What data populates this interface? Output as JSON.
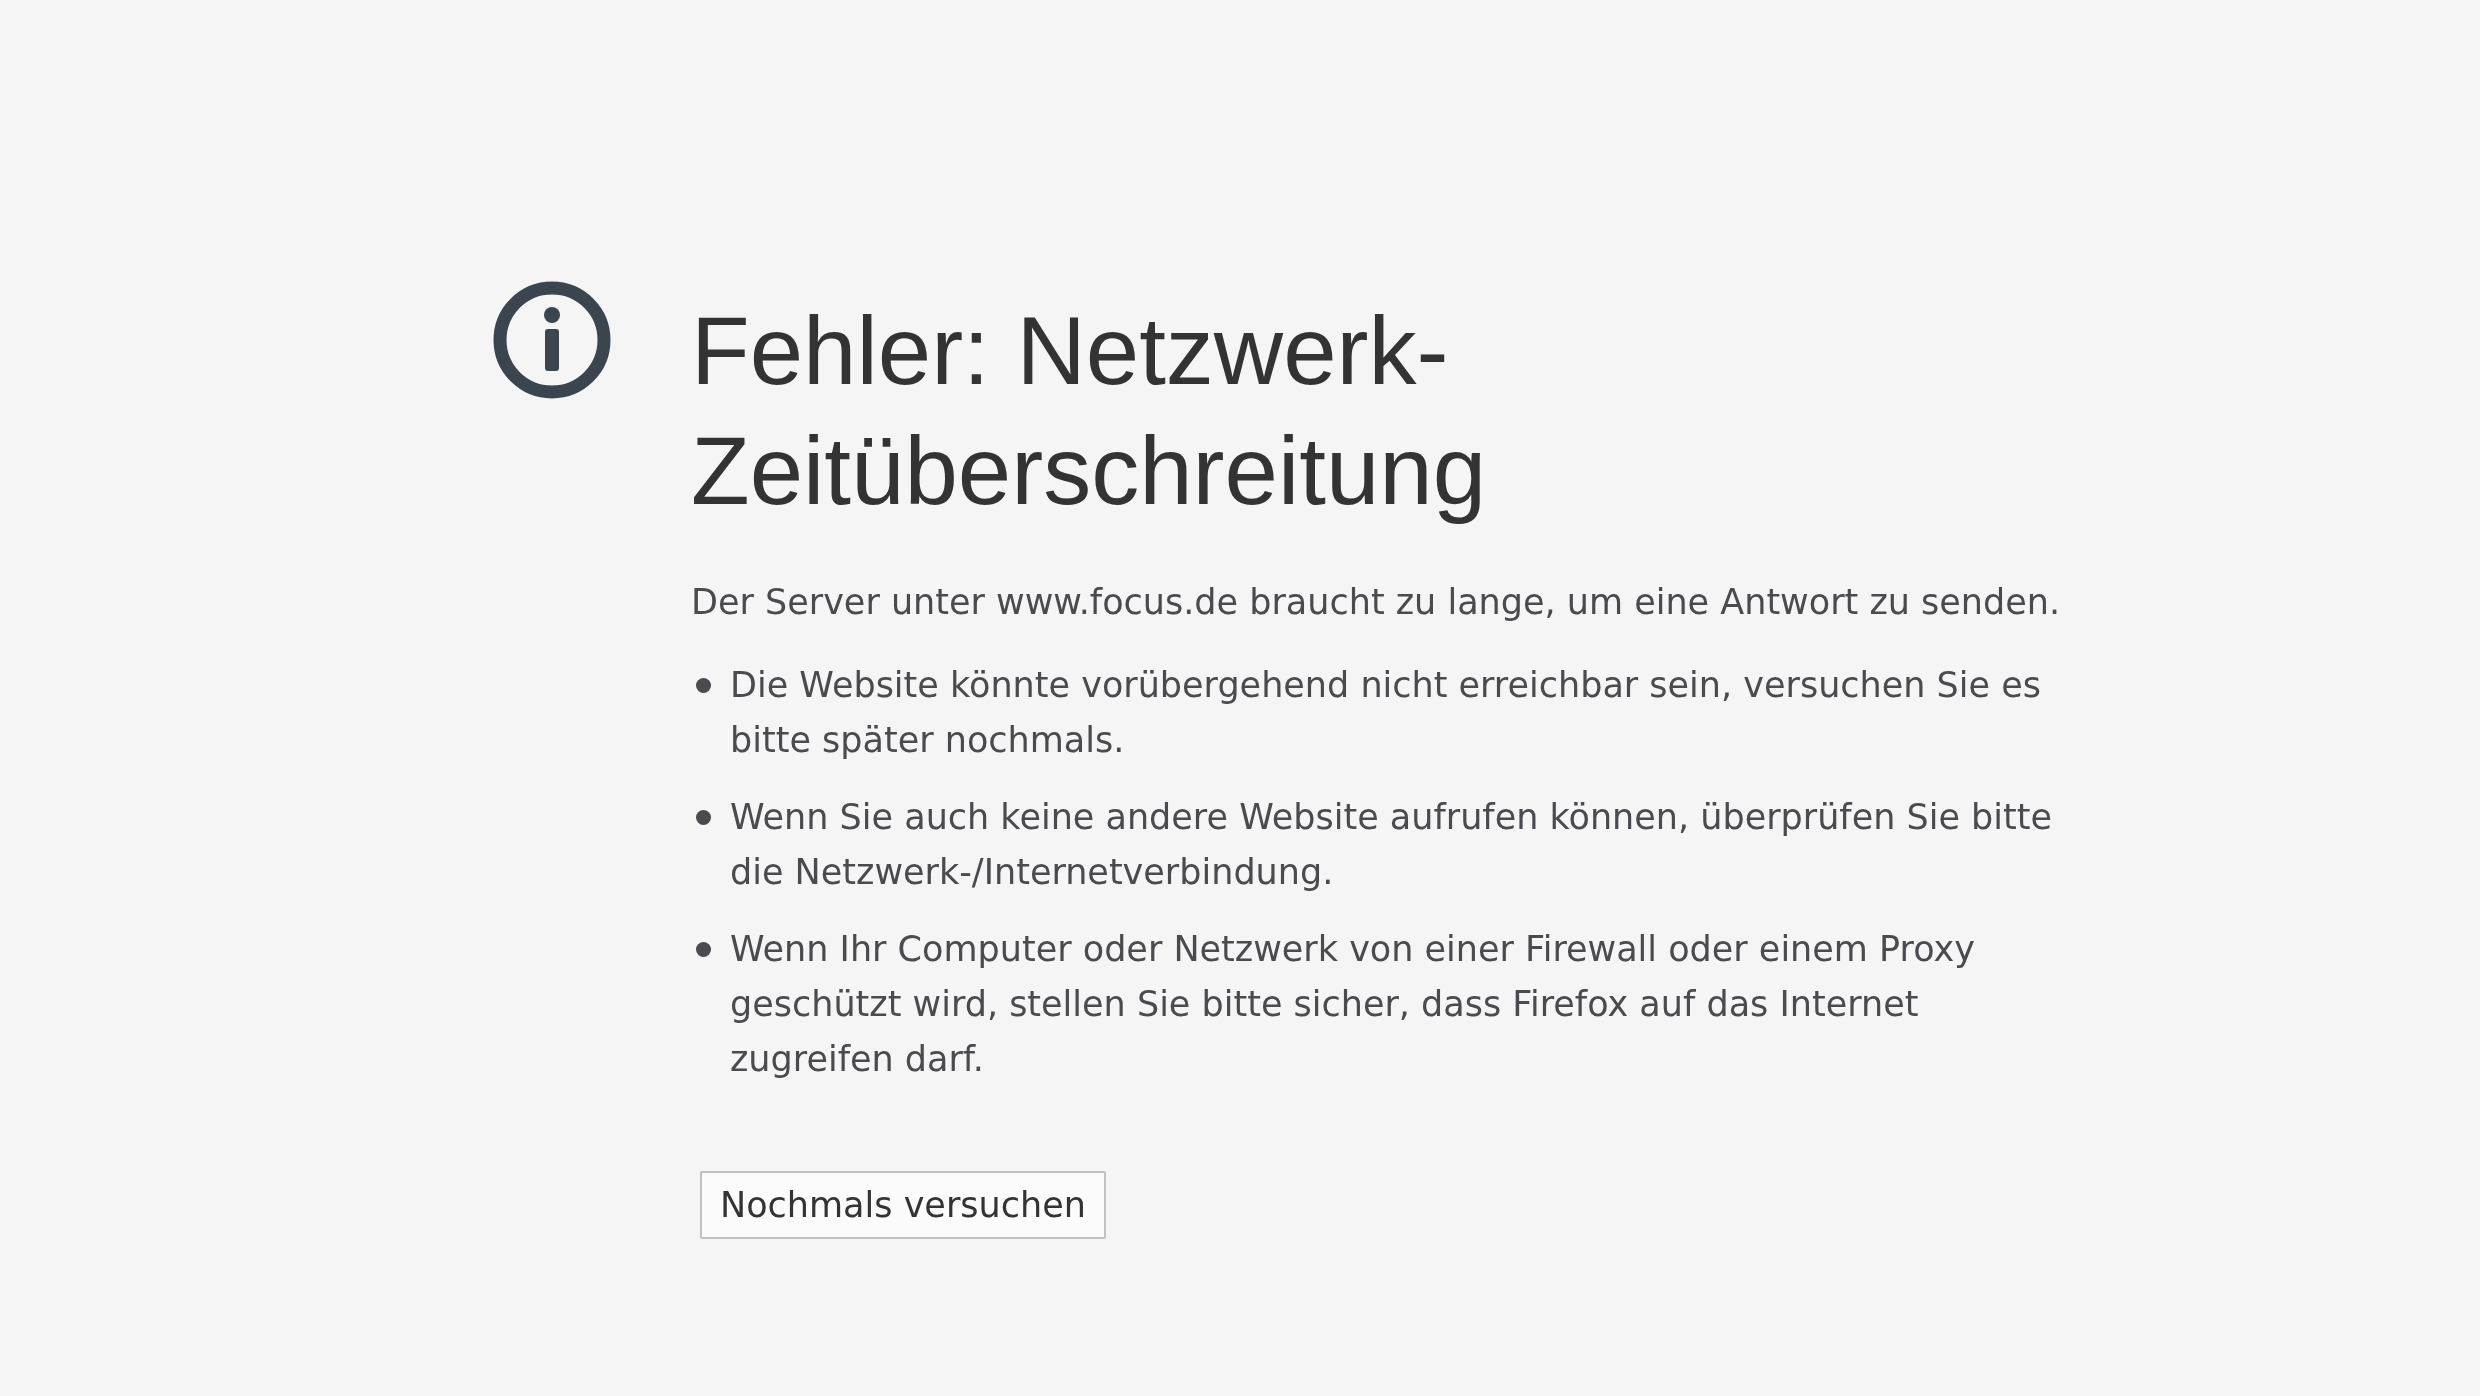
{
  "title": "Fehler: Netzwerk-Zeitüberschreitung",
  "description": "Der Server unter www.focus.de braucht zu lange, um eine Antwort zu senden.",
  "hints": [
    "Die Website könnte vorübergehend nicht erreichbar sein, versuchen Sie es bitte später nochmals.",
    "Wenn Sie auch keine andere Website aufrufen können, überprüfen Sie bitte die Netzwerk-/Internetverbindung.",
    "Wenn Ihr Computer oder Netzwerk von einer Firewall oder einem Proxy geschützt wird, stellen Sie bitte sicher, dass Firefox auf das Internet zugreifen darf."
  ],
  "button": "Nochmals versuchen"
}
